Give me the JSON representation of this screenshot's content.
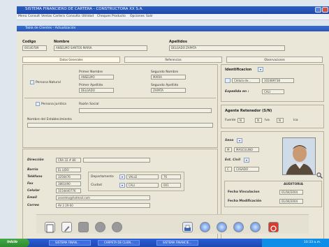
{
  "window": {
    "title": "SISTEMA FINANCIERO DE CARTERA - CONSTRUCTORA XX S.A."
  },
  "menu": [
    "Menú",
    "Consult",
    "Ventas",
    "Cartera",
    "Consulta",
    "Utilidad",
    "Cheques",
    "Producto",
    "Opciones",
    "Salir"
  ],
  "form": {
    "title": "Tabla de Clientes - Actualización"
  },
  "client": {
    "codigo_label": "Codigo",
    "codigo": "00140789",
    "nombre_label": "Nombre",
    "nombre": "ANSELMO SANTOS MARIA",
    "apellidos_label": "Apellidos",
    "apellidos": "DELGADO ZAPATA"
  },
  "tabs": [
    "Datos Generales",
    "Referencias",
    "Observaciones"
  ],
  "personal": {
    "persona_natural": "Persona Natural",
    "primer_nombre_label": "Primer Nombre",
    "primer_nombre": "ANSELMO",
    "segundo_nombre_label": "Segundo Nombre",
    "segundo_nombre": "MARIA",
    "primer_apellido_label": "Primer Apellido",
    "primer_apellido": "DELGADO",
    "segundo_apellido_label": "Segundo Apellido",
    "segundo_apellido": "ZAPATA",
    "persona_juridica": "Persona Juridica",
    "razon_social_label": "Razón Social",
    "nombre_comercial_label": "Nombre del Establecimiento"
  },
  "identificacion": {
    "label": "Identificacion",
    "tipo": "Cédula de...",
    "numero": "102489738",
    "expedida_label": "Expedida en :",
    "expedida": "CALI"
  },
  "agente": {
    "label": "Agente Retenedor (S/N)",
    "fuente": "Fuente",
    "iva": "Iva",
    "ica": "Ica",
    "value": "N"
  },
  "contacto": {
    "direccion_label": "Dirección",
    "direccion": "CRA 32 # 80",
    "barrio_label": "Barrio",
    "barrio": "EL LIDO",
    "telefono_label": "Teléfono",
    "telefono": "3256476",
    "fax_label": "Fax",
    "fax": "3861490",
    "celular_label": "Celular",
    "celular": "3154440776",
    "email_label": "Email",
    "email": "anselmo@hotmail.com",
    "correo_label": "Correo",
    "correo": "AV 2 29 60",
    "departamento_label": "Departamento",
    "departamento": "VALLE",
    "departamento_code": "76",
    "ciudad_label": "Ciudad",
    "ciudad": "CALI",
    "ciudad_code": "001"
  },
  "sexo": {
    "label": "Sexo",
    "value": "M",
    "desc": "MASCULINO"
  },
  "estado_civil": {
    "label": "Est. Civil",
    "value": "C",
    "desc": "CASADO"
  },
  "auditoria": {
    "header": "AUDITORIA",
    "vinculacion_label": "Fecha Vinculacion",
    "vinculacion": "01/04/2004",
    "modificacion_label": "Fecha Modificación",
    "modificacion": "01/04/2004"
  },
  "taskbar": {
    "start": "inicio",
    "items": [
      "SISTEMA FINAN...",
      "CARPETA DE CLIEN...",
      "SISTEMA FINANCIE..."
    ],
    "clock": "10:33 a.m."
  },
  "colors": {
    "title": "#2357c0",
    "form_bg": "#eae7d8",
    "taskbar": "#245edb",
    "start": "#3c9c3e"
  }
}
